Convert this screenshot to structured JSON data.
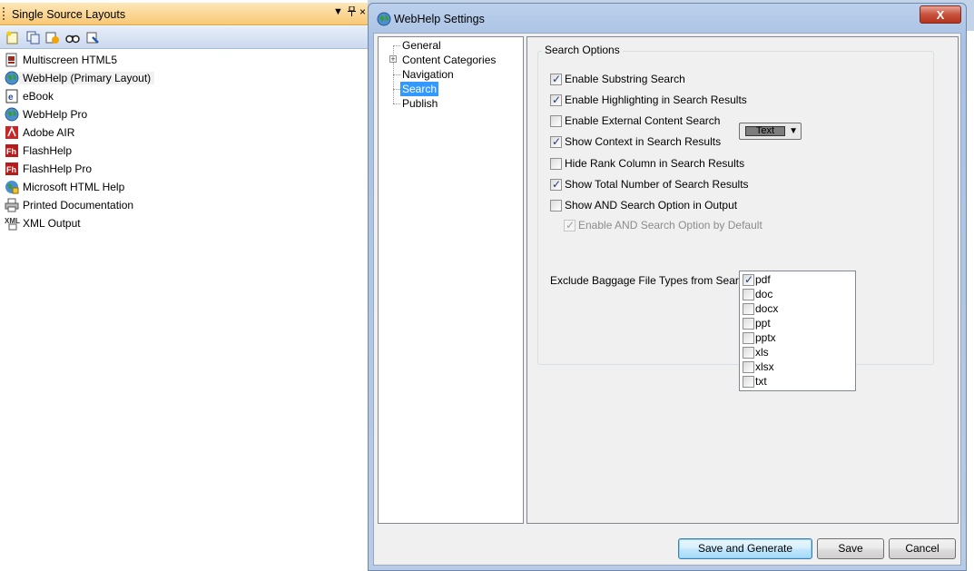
{
  "panel": {
    "title": "Single Source Layouts",
    "pin_icon": "pin-icon",
    "dropdown_icon": "chevron-down-icon",
    "close_label": "×",
    "toolbar_icons": [
      "new-layout-icon",
      "copy-layout-icon",
      "generate-icon",
      "view-icon",
      "properties-icon"
    ],
    "layouts": [
      {
        "label": "Multiscreen HTML5",
        "icon": "multiscreen-icon",
        "icon_color": "#9a2b1e"
      },
      {
        "label": "WebHelp (Primary Layout)",
        "icon": "globe-icon",
        "icon_color": "#2f7d32"
      },
      {
        "label": "eBook",
        "icon": "ebook-icon",
        "icon_color": "#2a4f8f"
      },
      {
        "label": "WebHelp Pro",
        "icon": "globe-pro-icon",
        "icon_color": "#2f7d32"
      },
      {
        "label": "Adobe AIR",
        "icon": "adobe-air-icon",
        "icon_color": "#c62828"
      },
      {
        "label": "FlashHelp",
        "icon": "flashhelp-icon",
        "icon_color": "#b71c1c"
      },
      {
        "label": "FlashHelp Pro",
        "icon": "flashhelp-pro-icon",
        "icon_color": "#b71c1c"
      },
      {
        "label": "Microsoft HTML Help",
        "icon": "html-help-icon",
        "icon_color": "#2e7d32"
      },
      {
        "label": "Printed Documentation",
        "icon": "printer-icon",
        "icon_color": "#555555"
      },
      {
        "label": "XML Output",
        "icon": "xml-icon",
        "icon_color": "#333333"
      }
    ]
  },
  "dialog": {
    "title": "WebHelp Settings",
    "close_label": "X",
    "tree": [
      {
        "label": "General"
      },
      {
        "label": "Content Categories"
      },
      {
        "label": "Navigation"
      },
      {
        "label": "Search"
      },
      {
        "label": "Publish"
      }
    ],
    "search_options": {
      "group_label": "Search Options",
      "options": [
        {
          "label": "Enable Substring Search",
          "checked": true
        },
        {
          "label": "Enable Highlighting in Search Results",
          "checked": true
        },
        {
          "label": "Enable External Content Search",
          "checked": false
        },
        {
          "label": "Show Context in Search Results",
          "checked": true
        },
        {
          "label": "Hide Rank Column in Search Results",
          "checked": false
        },
        {
          "label": "Show Total Number of Search Results",
          "checked": true
        },
        {
          "label": "Show AND Search Option in Output",
          "checked": false
        },
        {
          "label": "Enable AND Search Option by Default",
          "checked": true,
          "disabled": true
        }
      ],
      "highlight_color_label": "Text",
      "exclude_label": "Exclude Baggage File Types from Search :",
      "file_types": [
        {
          "label": "pdf",
          "checked": true
        },
        {
          "label": "doc",
          "checked": false
        },
        {
          "label": "docx",
          "checked": false
        },
        {
          "label": "ppt",
          "checked": false
        },
        {
          "label": "pptx",
          "checked": false
        },
        {
          "label": "xls",
          "checked": false
        },
        {
          "label": "xlsx",
          "checked": false
        },
        {
          "label": "txt",
          "checked": false
        }
      ]
    },
    "buttons": {
      "save_generate": "Save and Generate",
      "save": "Save",
      "cancel": "Cancel"
    }
  },
  "colors": {
    "selection": "#3399ff",
    "panel_title": "#f8c876",
    "dialog_frame": "#a9c2e4",
    "close_button": "#c7513e"
  }
}
